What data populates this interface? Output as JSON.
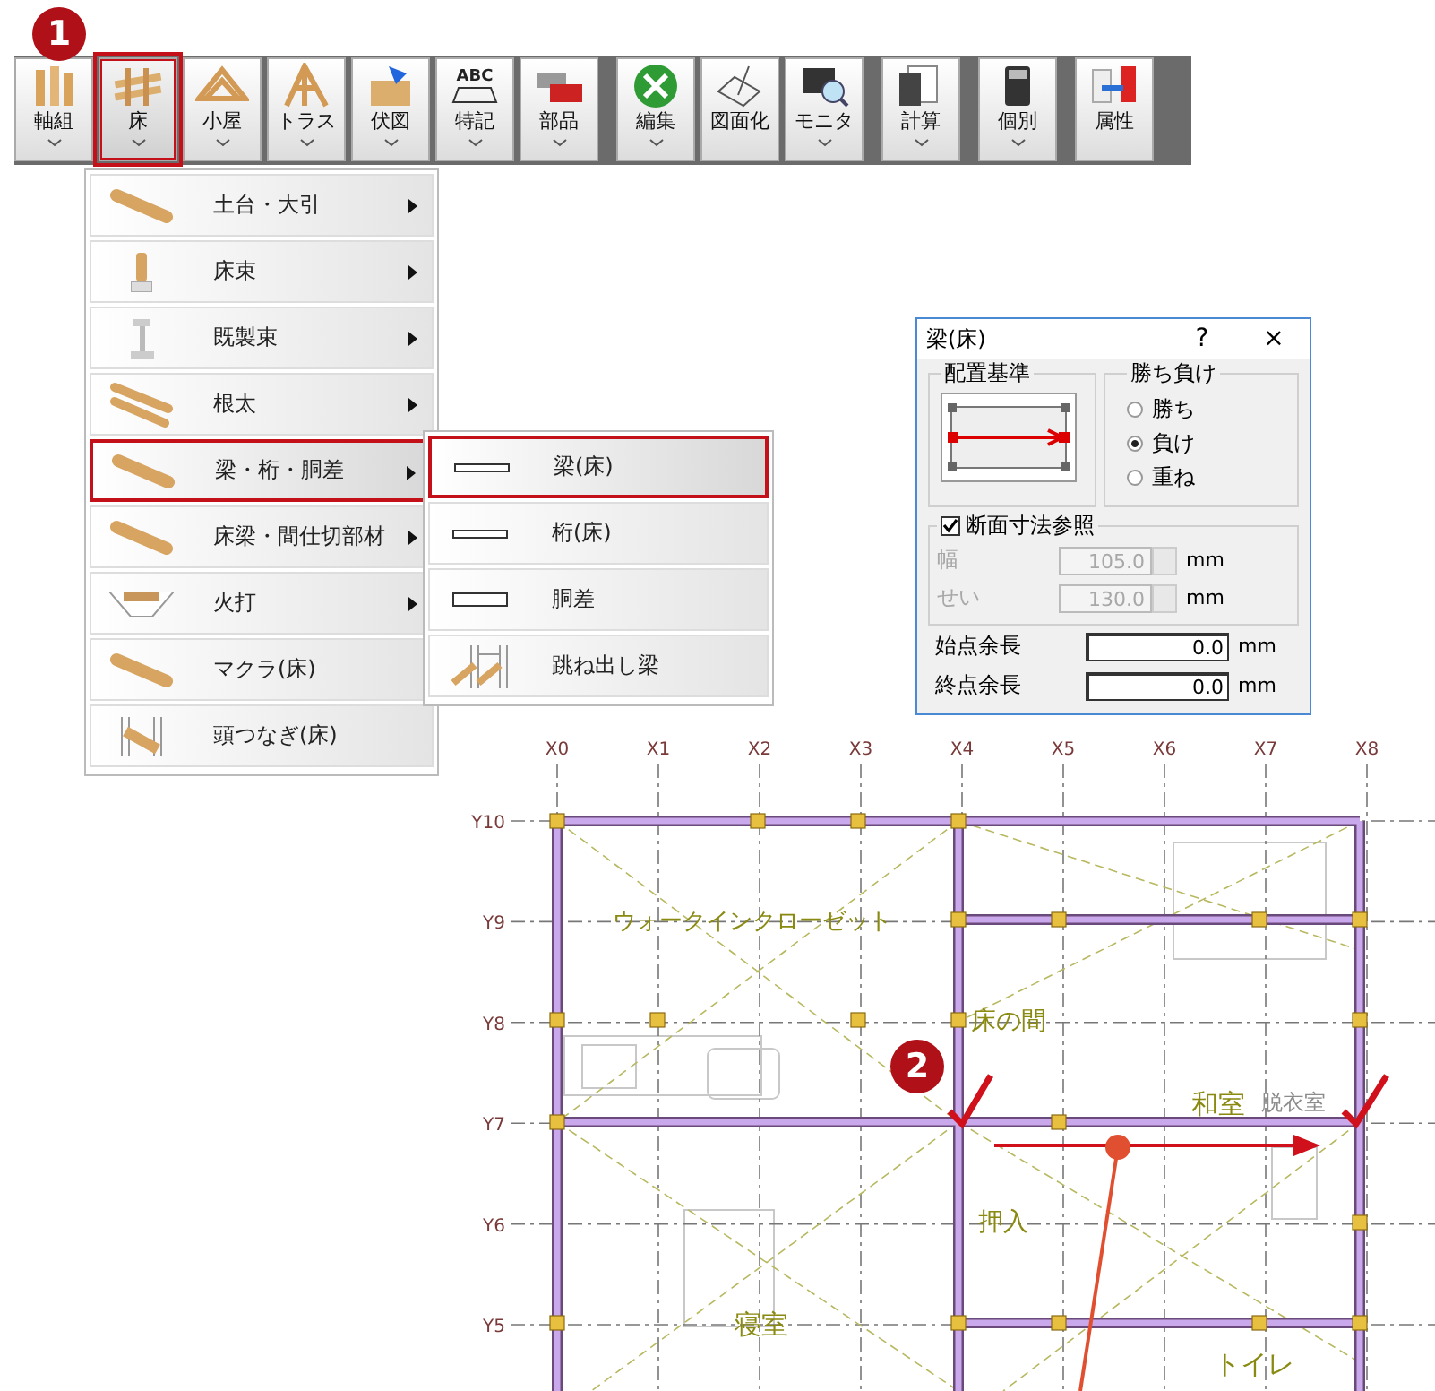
{
  "toolbar": {
    "step_badge": "1",
    "buttons": [
      {
        "label": "軸組",
        "kind": "posts",
        "has_menu": true,
        "selected": false
      },
      {
        "label": "床",
        "kind": "floor",
        "has_menu": true,
        "selected": true
      },
      {
        "label": "小屋",
        "kind": "roof",
        "has_menu": true,
        "selected": false
      },
      {
        "label": "トラス",
        "kind": "truss",
        "has_menu": true,
        "selected": false
      },
      {
        "label": "伏図",
        "kind": "plan",
        "has_menu": true,
        "selected": false
      },
      {
        "label": "特記",
        "kind": "note",
        "icon_text": "ABC",
        "has_menu": true,
        "selected": false
      },
      {
        "label": "部品",
        "kind": "parts",
        "has_menu": true,
        "selected": false
      },
      {
        "label": "編集",
        "kind": "edit",
        "has_menu": true,
        "selected": false
      },
      {
        "label": "図面化",
        "kind": "drawing",
        "has_menu": false,
        "selected": false
      },
      {
        "label": "モニタ",
        "kind": "monitor",
        "has_menu": true,
        "selected": false
      },
      {
        "label": "計算",
        "kind": "calc",
        "has_menu": true,
        "selected": false
      },
      {
        "label": "個別",
        "kind": "single",
        "has_menu": true,
        "selected": false
      },
      {
        "label": "属性",
        "kind": "attribute",
        "has_menu": false,
        "selected": false
      }
    ]
  },
  "menu": {
    "items": [
      {
        "label": "土台・大引",
        "kind": "beam",
        "has_submenu": true,
        "selected": false
      },
      {
        "label": "床束",
        "kind": "post",
        "has_submenu": true,
        "selected": false
      },
      {
        "label": "既製束",
        "kind": "metal-post",
        "has_submenu": true,
        "selected": false
      },
      {
        "label": "根太",
        "kind": "joists",
        "has_submenu": true,
        "selected": false
      },
      {
        "label": "梁・桁・胴差",
        "kind": "beam",
        "has_submenu": true,
        "selected": true
      },
      {
        "label": "床梁・間仕切部材",
        "kind": "beam",
        "has_submenu": true,
        "selected": false
      },
      {
        "label": "火打",
        "kind": "brace",
        "has_submenu": true,
        "selected": false
      },
      {
        "label": "マクラ(床)",
        "kind": "beam",
        "has_submenu": false,
        "selected": false
      },
      {
        "label": "頭つなぎ(床)",
        "kind": "tie",
        "has_submenu": false,
        "selected": false
      }
    ]
  },
  "submenu": {
    "items": [
      {
        "label": "梁(床)",
        "kind": "line",
        "selected": true
      },
      {
        "label": "桁(床)",
        "kind": "line",
        "selected": false
      },
      {
        "label": "胴差",
        "kind": "box",
        "selected": false
      },
      {
        "label": "跳ね出し梁",
        "kind": "cantilever",
        "selected": false
      }
    ]
  },
  "dialog": {
    "title": "梁(床)",
    "help": "?",
    "close": "×",
    "placement_group": "配置基準",
    "priority_group": "勝ち負け",
    "priority_options": [
      {
        "label": "勝ち",
        "selected": false
      },
      {
        "label": "負け",
        "selected": true
      },
      {
        "label": "重ね",
        "selected": false
      }
    ],
    "section_ref": {
      "label": "断面寸法参照",
      "checked": true
    },
    "section_fields": [
      {
        "label": "幅",
        "value": "105.0",
        "unit": "mm",
        "disabled": true
      },
      {
        "label": "せい",
        "value": "130.0",
        "unit": "mm",
        "disabled": true
      }
    ],
    "extension_fields": [
      {
        "label": "始点余長",
        "value": "0.0",
        "unit": "mm"
      },
      {
        "label": "終点余長",
        "value": "0.0",
        "unit": "mm"
      }
    ]
  },
  "plan": {
    "step_badge": "2",
    "x_axes": [
      "X0",
      "X1",
      "X2",
      "X3",
      "X4",
      "X5",
      "X6",
      "X7",
      "X8"
    ],
    "y_axes": [
      "Y10",
      "Y9",
      "Y8",
      "Y7",
      "Y6",
      "Y5"
    ],
    "rooms": [
      {
        "label": "ウォークインクローゼット",
        "faded": false
      },
      {
        "label": "床の間",
        "faded": false
      },
      {
        "label": "和室",
        "faded": false
      },
      {
        "label": "脱衣室",
        "faded": true
      },
      {
        "label": "押入",
        "faded": false
      },
      {
        "label": "寝室",
        "faded": false
      },
      {
        "label": "トイレ",
        "faded": false
      }
    ]
  }
}
